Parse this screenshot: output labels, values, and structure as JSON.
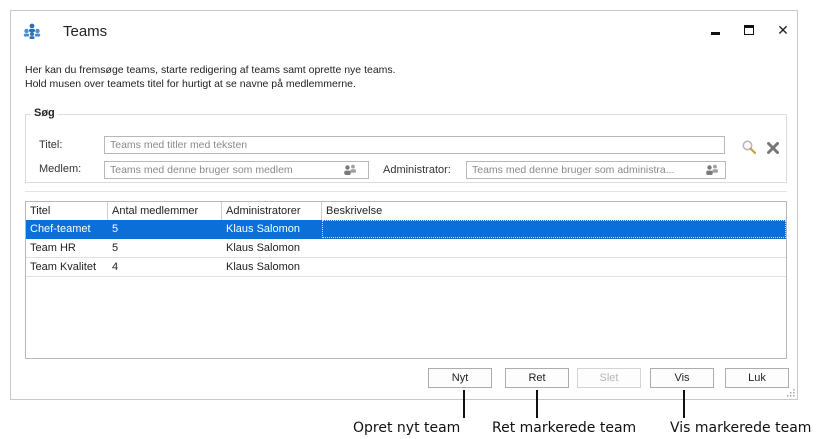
{
  "window": {
    "title": "Teams",
    "description_line1": "Her kan du fremsøge teams, starte redigering af teams samt oprette nye teams.",
    "description_line2": "Hold musen over teamets titel for hurtigt at se navne på medlemmerne."
  },
  "search": {
    "legend": "Søg",
    "title_label": "Titel:",
    "title_placeholder": "Teams med titler med teksten",
    "member_label": "Medlem:",
    "member_placeholder": "Teams med denne bruger som medlem",
    "admin_label": "Administrator:",
    "admin_placeholder": "Teams med denne bruger som administra..."
  },
  "grid": {
    "columns": [
      "Titel",
      "Antal medlemmer",
      "Administratorer",
      "Beskrivelse"
    ],
    "rows": [
      {
        "titel": "Chef-teamet",
        "antal": "5",
        "admin": "Klaus Salomon",
        "beskrivelse": "",
        "selected": true
      },
      {
        "titel": "Team HR",
        "antal": "5",
        "admin": "Klaus Salomon",
        "beskrivelse": "",
        "selected": false
      },
      {
        "titel": "Team Kvalitet",
        "antal": "4",
        "admin": "Klaus Salomon",
        "beskrivelse": "",
        "selected": false
      }
    ]
  },
  "buttons": {
    "nyt": "Nyt",
    "ret": "Ret",
    "slet": "Slet",
    "vis": "Vis",
    "luk": "Luk"
  },
  "callouts": {
    "nyt": "Opret nyt team",
    "ret": "Ret markerede team",
    "vis": "Vis markerede team"
  },
  "colors": {
    "selection": "#0a6fd8",
    "app_icon": "#2a6fb7"
  },
  "icons": [
    "teams-icon",
    "minimize-icon",
    "maximize-icon",
    "close-icon",
    "user-picker-icon",
    "search-icon",
    "clear-icon",
    "resize-grip-icon"
  ]
}
